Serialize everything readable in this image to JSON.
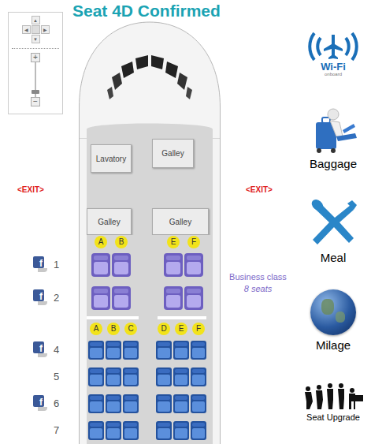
{
  "title": "Seat 4D Confirmed",
  "zoom_control": {
    "pan": [
      "▲",
      "◀",
      "▶",
      "▼"
    ],
    "zoom_in": "+",
    "zoom_out": "−",
    "level": 0.1
  },
  "cabin": {
    "front": [
      {
        "label": "Lavatory"
      },
      {
        "label": "Galley"
      }
    ],
    "exits": [
      "<EXIT>",
      "<EXIT>"
    ],
    "galleys": [
      "Galley",
      "Galley"
    ]
  },
  "share_glyph": "f",
  "business": {
    "label": "Business class",
    "count": "8 seats",
    "left_columns": [
      "A",
      "B"
    ],
    "right_columns": [
      "E",
      "F"
    ],
    "rows": [
      {
        "number": "1",
        "share": true
      },
      {
        "number": "2",
        "share": true
      }
    ]
  },
  "economy": {
    "left_columns": [
      "A",
      "B",
      "C"
    ],
    "right_columns": [
      "D",
      "E",
      "F"
    ],
    "rows": [
      {
        "number": "4",
        "share": true
      },
      {
        "number": "5",
        "share": false
      },
      {
        "number": "6",
        "share": true
      },
      {
        "number": "7",
        "share": false
      }
    ]
  },
  "wifi": {
    "label": "Wi-Fi",
    "caption": "onboard"
  },
  "menu": [
    {
      "label": "Baggage"
    },
    {
      "label": "Meal"
    },
    {
      "label": "Milage"
    },
    {
      "label": "Seat Upgrade"
    }
  ]
}
